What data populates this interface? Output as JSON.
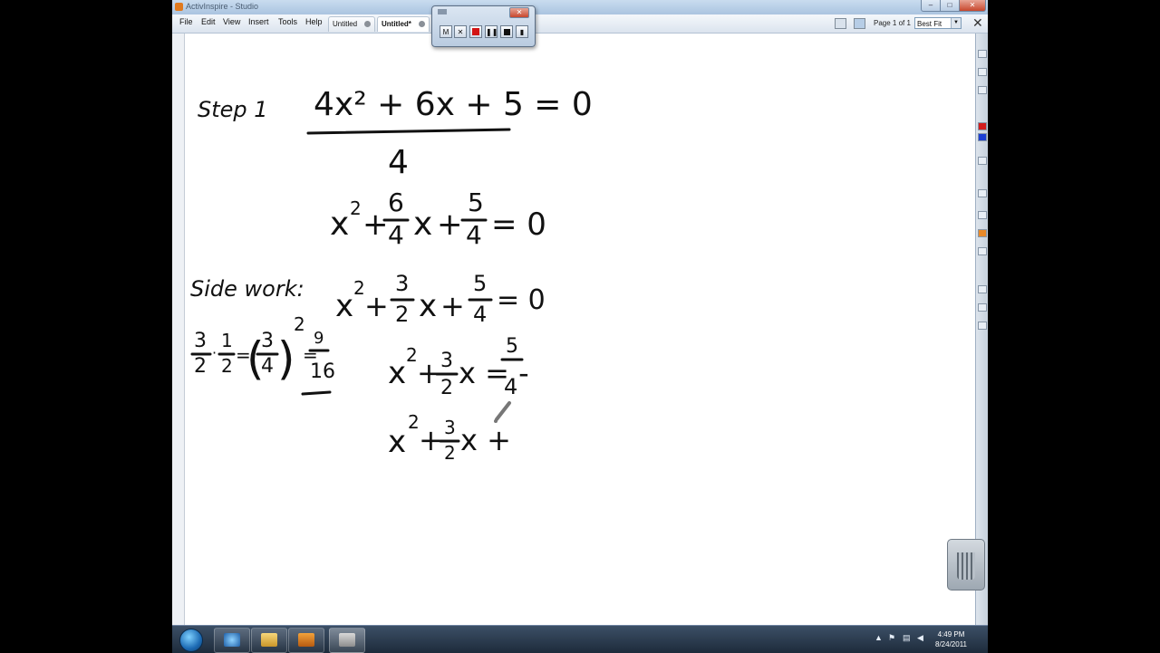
{
  "window": {
    "title": "ActivInspire - Studio",
    "controls": {
      "minimize": "–",
      "maximize": "□",
      "close": "✕"
    }
  },
  "menu": [
    {
      "label": "File"
    },
    {
      "label": "Edit"
    },
    {
      "label": "View"
    },
    {
      "label": "Insert"
    },
    {
      "label": "Tools"
    },
    {
      "label": "Help"
    }
  ],
  "tabs": [
    {
      "label": "Untitled",
      "active": false
    },
    {
      "label": "Untitled*",
      "active": true
    }
  ],
  "page_indicator": "Page 1 of 1",
  "zoom": {
    "selected": "Best Fit"
  },
  "close_glyph": "✕",
  "recorder": {
    "buttons": [
      {
        "label": "M",
        "icon": "minimize-icon"
      },
      {
        "label": "✕",
        "icon": "close-icon"
      },
      {
        "label": "",
        "icon": "record-icon"
      },
      {
        "label": "❚❚",
        "icon": "pause-icon"
      },
      {
        "label": "",
        "icon": "stop-icon"
      },
      {
        "label": "▮",
        "icon": "options-icon"
      }
    ],
    "close_glyph": "✕"
  },
  "flipchart": {
    "handwriting": {
      "step_label": "Step 1",
      "eq1": "4x² + 6x + 5 = 0",
      "eq1_divisor": "4",
      "eq2": "x² + 6/4 x + 5/4 = 0",
      "side_work_label": "Side work:",
      "side_work": "3/2 · 1/2 = (3/4)² = 9/16",
      "eq3": "x² + 3/2 x + 5/4 = 0",
      "eq4": "x² + 3/2 x = -5/4",
      "eq5": "x² + 3/2 x +"
    }
  },
  "taskbar": {
    "clock_time": "4:49 PM",
    "clock_date": "8/24/2011",
    "apps": [
      {
        "icon": "internet-explorer-icon"
      },
      {
        "icon": "file-explorer-icon"
      },
      {
        "icon": "media-player-icon"
      },
      {
        "icon": "activinspire-icon"
      }
    ]
  },
  "colors": {
    "accent": "#1c6ab3",
    "ink": "#111111",
    "taskbar": "#1d2b3b"
  }
}
